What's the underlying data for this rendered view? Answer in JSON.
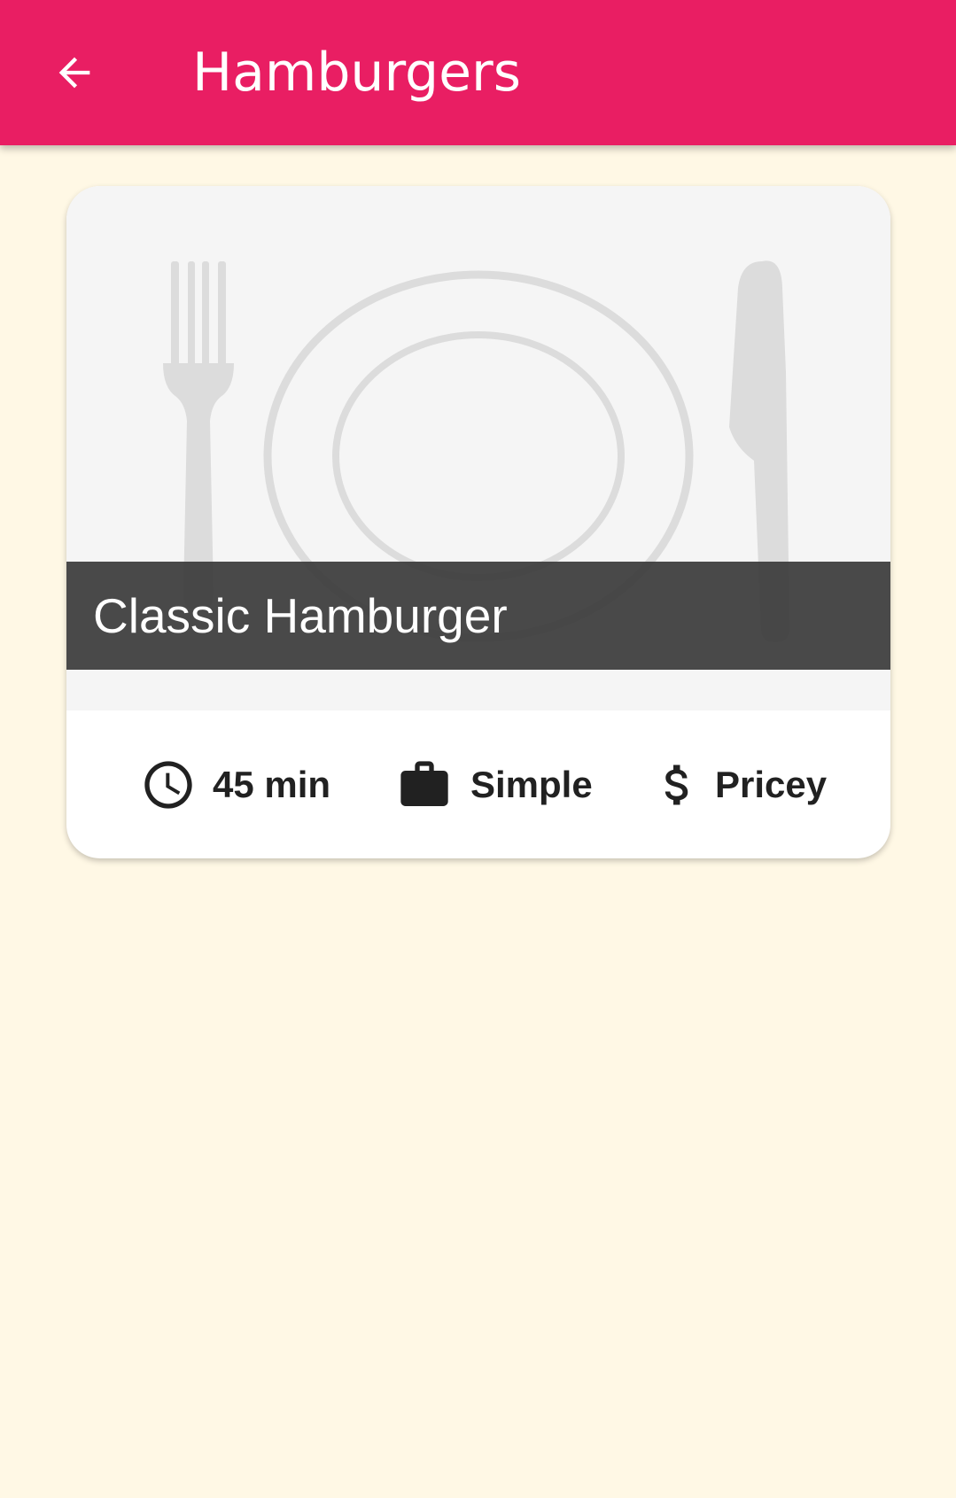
{
  "appbar": {
    "title": "Hamburgers",
    "back_icon": "arrow-back-icon",
    "color": "#E91E63"
  },
  "background_color": "#FFF8E5",
  "meal": {
    "title": "Classic Hamburger",
    "image_icon": "plate-placeholder-icon",
    "duration": "45 min",
    "duration_icon": "schedule-icon",
    "complexity": "Simple",
    "complexity_icon": "work-icon",
    "affordability": "Pricey",
    "affordability_icon": "attach-money-icon"
  }
}
